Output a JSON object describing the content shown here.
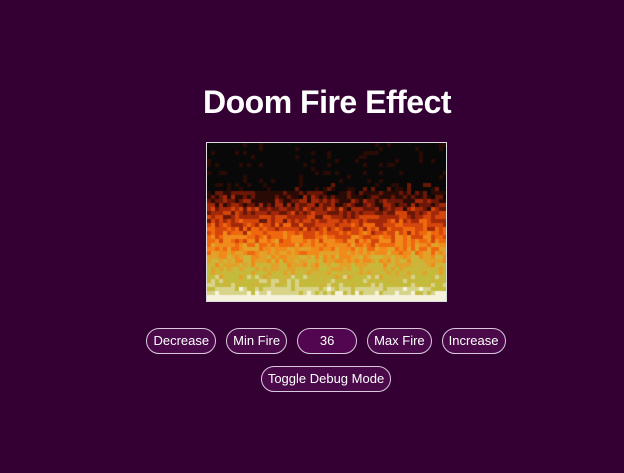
{
  "header": {
    "title": "Doom Fire Effect"
  },
  "canvas": {
    "background": "#080808",
    "palette": [
      "#080808",
      "#2a0a05",
      "#6a1707",
      "#a3280a",
      "#d4460b",
      "#f0680e",
      "#f08a1a",
      "#e2a22a",
      "#cdb53a",
      "#c3bb3c",
      "#d7d48a",
      "#f5f2dc"
    ]
  },
  "controls": {
    "decrease_label": "Decrease",
    "min_fire_label": "Min Fire",
    "fire_value": "36",
    "max_fire_label": "Max Fire",
    "increase_label": "Increase",
    "debug_label": "Toggle Debug Mode"
  },
  "colors": {
    "page_background": "#340034",
    "button_background": "#4a0a4a",
    "button_border": "#d9c9dc",
    "text": "#ffffff"
  }
}
